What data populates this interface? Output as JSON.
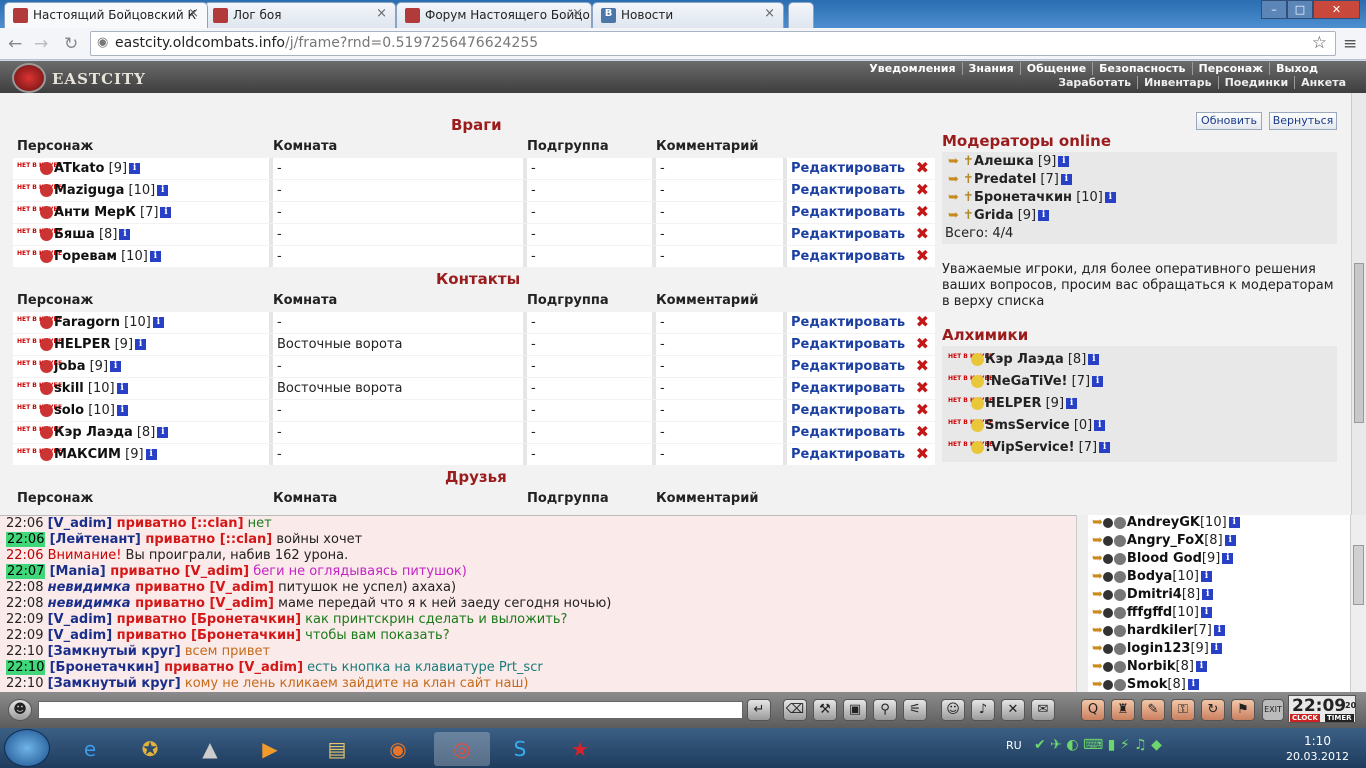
{
  "browser": {
    "tabs": [
      {
        "label": "Настоящий Бойцовский К",
        "color": "#b23a3a"
      },
      {
        "label": "Лог боя",
        "color": "#b23a3a"
      },
      {
        "label": "Форум Настоящего Бойцо",
        "color": "#b23a3a"
      },
      {
        "label": "Новости",
        "color": "#4a76a8"
      }
    ],
    "url_host": "eastcity.oldcombats.info",
    "url_path": "/j/frame?rnd=0.5197256476624255"
  },
  "game": {
    "logo": "EASTCITY",
    "menu_top": [
      "Уведомления",
      "Знания",
      "Общение",
      "Безопасность",
      "Персонаж",
      "Выход"
    ],
    "menu_bottom": [
      "Заработать",
      "Инвентарь",
      "Поединки",
      "Анкета"
    ]
  },
  "buttons": {
    "refresh": "Обновить",
    "back": "Вернуться"
  },
  "columns": {
    "person": "Персонаж",
    "room": "Комната",
    "subgroup": "Подгруппа",
    "comment": "Комментарий"
  },
  "edit_label": "Редактировать",
  "offline_tag": "НЕТ В КЛУБЕ",
  "sections": {
    "enemies": {
      "title": "Враги",
      "rows": [
        {
          "name": "ATkato",
          "level": "[9]",
          "room": "-",
          "sub": "-",
          "comment": "-"
        },
        {
          "name": "Maziguga",
          "level": "[10]",
          "room": "-",
          "sub": "-",
          "comment": "-"
        },
        {
          "name": "Анти МерК",
          "level": "[7]",
          "room": "-",
          "sub": "-",
          "comment": "-"
        },
        {
          "name": "Бяша",
          "level": "[8]",
          "room": "-",
          "sub": "-",
          "comment": "-"
        },
        {
          "name": "Горевам",
          "level": "[10]",
          "room": "-",
          "sub": "-",
          "comment": "-"
        }
      ]
    },
    "contacts": {
      "title": "Контакты",
      "rows": [
        {
          "name": "Faragorn",
          "level": "[10]",
          "room": "-",
          "sub": "-",
          "comment": "-"
        },
        {
          "name": "HELPER",
          "level": "[9]",
          "room": "Восточные ворота",
          "sub": "-",
          "comment": "-"
        },
        {
          "name": "joba",
          "level": "[9]",
          "room": "-",
          "sub": "-",
          "comment": "-"
        },
        {
          "name": "skill",
          "level": "[10]",
          "room": "Восточные ворота",
          "sub": "-",
          "comment": "-"
        },
        {
          "name": "solo",
          "level": "[10]",
          "room": "-",
          "sub": "-",
          "comment": "-"
        },
        {
          "name": "Кэр Лаэда",
          "level": "[8]",
          "room": "-",
          "sub": "-",
          "comment": "-"
        },
        {
          "name": "МАКСИМ",
          "level": "[9]",
          "room": "-",
          "sub": "-",
          "comment": "-"
        }
      ]
    },
    "friends": {
      "title": "Друзья"
    }
  },
  "moderators": {
    "title": "Модераторы online",
    "list": [
      {
        "name": "Алешка",
        "level": "[9]"
      },
      {
        "name": "Predatel",
        "level": "[7]"
      },
      {
        "name": "Бронетачкин",
        "level": "[10]"
      },
      {
        "name": "Grida",
        "level": "[9]"
      }
    ],
    "total": "Всего: 4/4",
    "notice": "Уважаемые игроки, для более оперативного решения ваших вопросов, просим вас обращаться к модераторам в верху списка"
  },
  "alchemists": {
    "title": "Алхимики",
    "list": [
      {
        "name": "Кэр Лаэда",
        "level": "[8]"
      },
      {
        "name": "!NeGaTiVe!",
        "level": "[7]"
      },
      {
        "name": "HELPER",
        "level": "[9]"
      },
      {
        "name": "SmsService",
        "level": "[0]"
      },
      {
        "name": "!VipService!",
        "level": "[7]"
      }
    ]
  },
  "chat": [
    {
      "time": "22:06",
      "hl": false,
      "parts": [
        [
          "who",
          "[V_adim]"
        ],
        [
          "priv",
          " приватно [::clan]"
        ],
        [
          "msg",
          " нет",
          "#1a7a1a"
        ]
      ]
    },
    {
      "time": "22:06",
      "hl": true,
      "parts": [
        [
          "who",
          "[Лейтенант]"
        ],
        [
          "priv",
          " приватно [::clan]"
        ],
        [
          "msg",
          " войны хочет",
          "#222"
        ]
      ]
    },
    {
      "time": "22:06",
      "hl": false,
      "red": true,
      "parts": [
        [
          "msg",
          "Внимание!",
          "#c00"
        ],
        [
          "msg",
          " Вы проиграли, набив 162 урона.",
          "#222"
        ]
      ]
    },
    {
      "time": "22:07",
      "hl": true,
      "parts": [
        [
          "who",
          "[Mania]"
        ],
        [
          "priv",
          " приватно [V_adim]"
        ],
        [
          "msg",
          " беги не оглядываясь питушок)",
          "#c423c4"
        ]
      ]
    },
    {
      "time": "22:08",
      "hl": false,
      "parts": [
        [
          "invis",
          "невидимка"
        ],
        [
          "priv",
          " приватно [V_adim]"
        ],
        [
          "msg",
          " питушок не успел) ахаха)",
          "#222"
        ]
      ]
    },
    {
      "time": "22:08",
      "hl": false,
      "parts": [
        [
          "invis",
          "невидимка"
        ],
        [
          "priv",
          " приватно [V_adim]"
        ],
        [
          "msg",
          " маме передай что я к ней заеду сегодня ночью)",
          "#222"
        ]
      ]
    },
    {
      "time": "22:09",
      "hl": false,
      "parts": [
        [
          "who",
          "[V_adim]"
        ],
        [
          "priv",
          " приватно [Бронетачкин]"
        ],
        [
          "msg",
          " как принтскрин сделать и выложить?",
          "#1a7a1a"
        ]
      ]
    },
    {
      "time": "22:09",
      "hl": false,
      "parts": [
        [
          "who",
          "[V_adim]"
        ],
        [
          "priv",
          " приватно [Бронетачкин]"
        ],
        [
          "msg",
          " чтобы вам показать?",
          "#1a7a1a"
        ]
      ]
    },
    {
      "time": "22:10",
      "hl": false,
      "parts": [
        [
          "who",
          "[Замкнутый круг]"
        ],
        [
          "msg",
          " всем привет",
          "#c46a1a"
        ]
      ]
    },
    {
      "time": "22:10",
      "hl": true,
      "parts": [
        [
          "who",
          "[Бронетачкин]"
        ],
        [
          "priv",
          " приватно [V_adim]"
        ],
        [
          "msg",
          " есть кнопка на клавиатуре Prt_scr",
          "#1a7a7a"
        ]
      ]
    },
    {
      "time": "22:10",
      "hl": false,
      "parts": [
        [
          "who",
          "[Замкнутый круг]"
        ],
        [
          "msg",
          " кому не лень кликаем зайдите на клан сайт наш)",
          "#c46a1a"
        ]
      ]
    }
  ],
  "online_users": [
    {
      "name": "AndreyGK",
      "level": "[10]"
    },
    {
      "name": "Angry_FoX",
      "level": "[8]"
    },
    {
      "name": "Blood God",
      "level": "[9]"
    },
    {
      "name": "Bodya",
      "level": "[10]"
    },
    {
      "name": "Dmitri4",
      "level": "[8]"
    },
    {
      "name": "fffgffd",
      "level": "[10]"
    },
    {
      "name": "hardkiler",
      "level": "[7]"
    },
    {
      "name": "login123",
      "level": "[9]"
    },
    {
      "name": "Norbik",
      "level": "[8]"
    },
    {
      "name": "Smok",
      "level": "[8]"
    }
  ],
  "clock": {
    "time": "22:09",
    "seconds": "20",
    "label": "CLOCK",
    "label2": "TIMER"
  },
  "taskbar": {
    "lang": "RU",
    "time": "1:10",
    "date": "20.03.2012"
  }
}
